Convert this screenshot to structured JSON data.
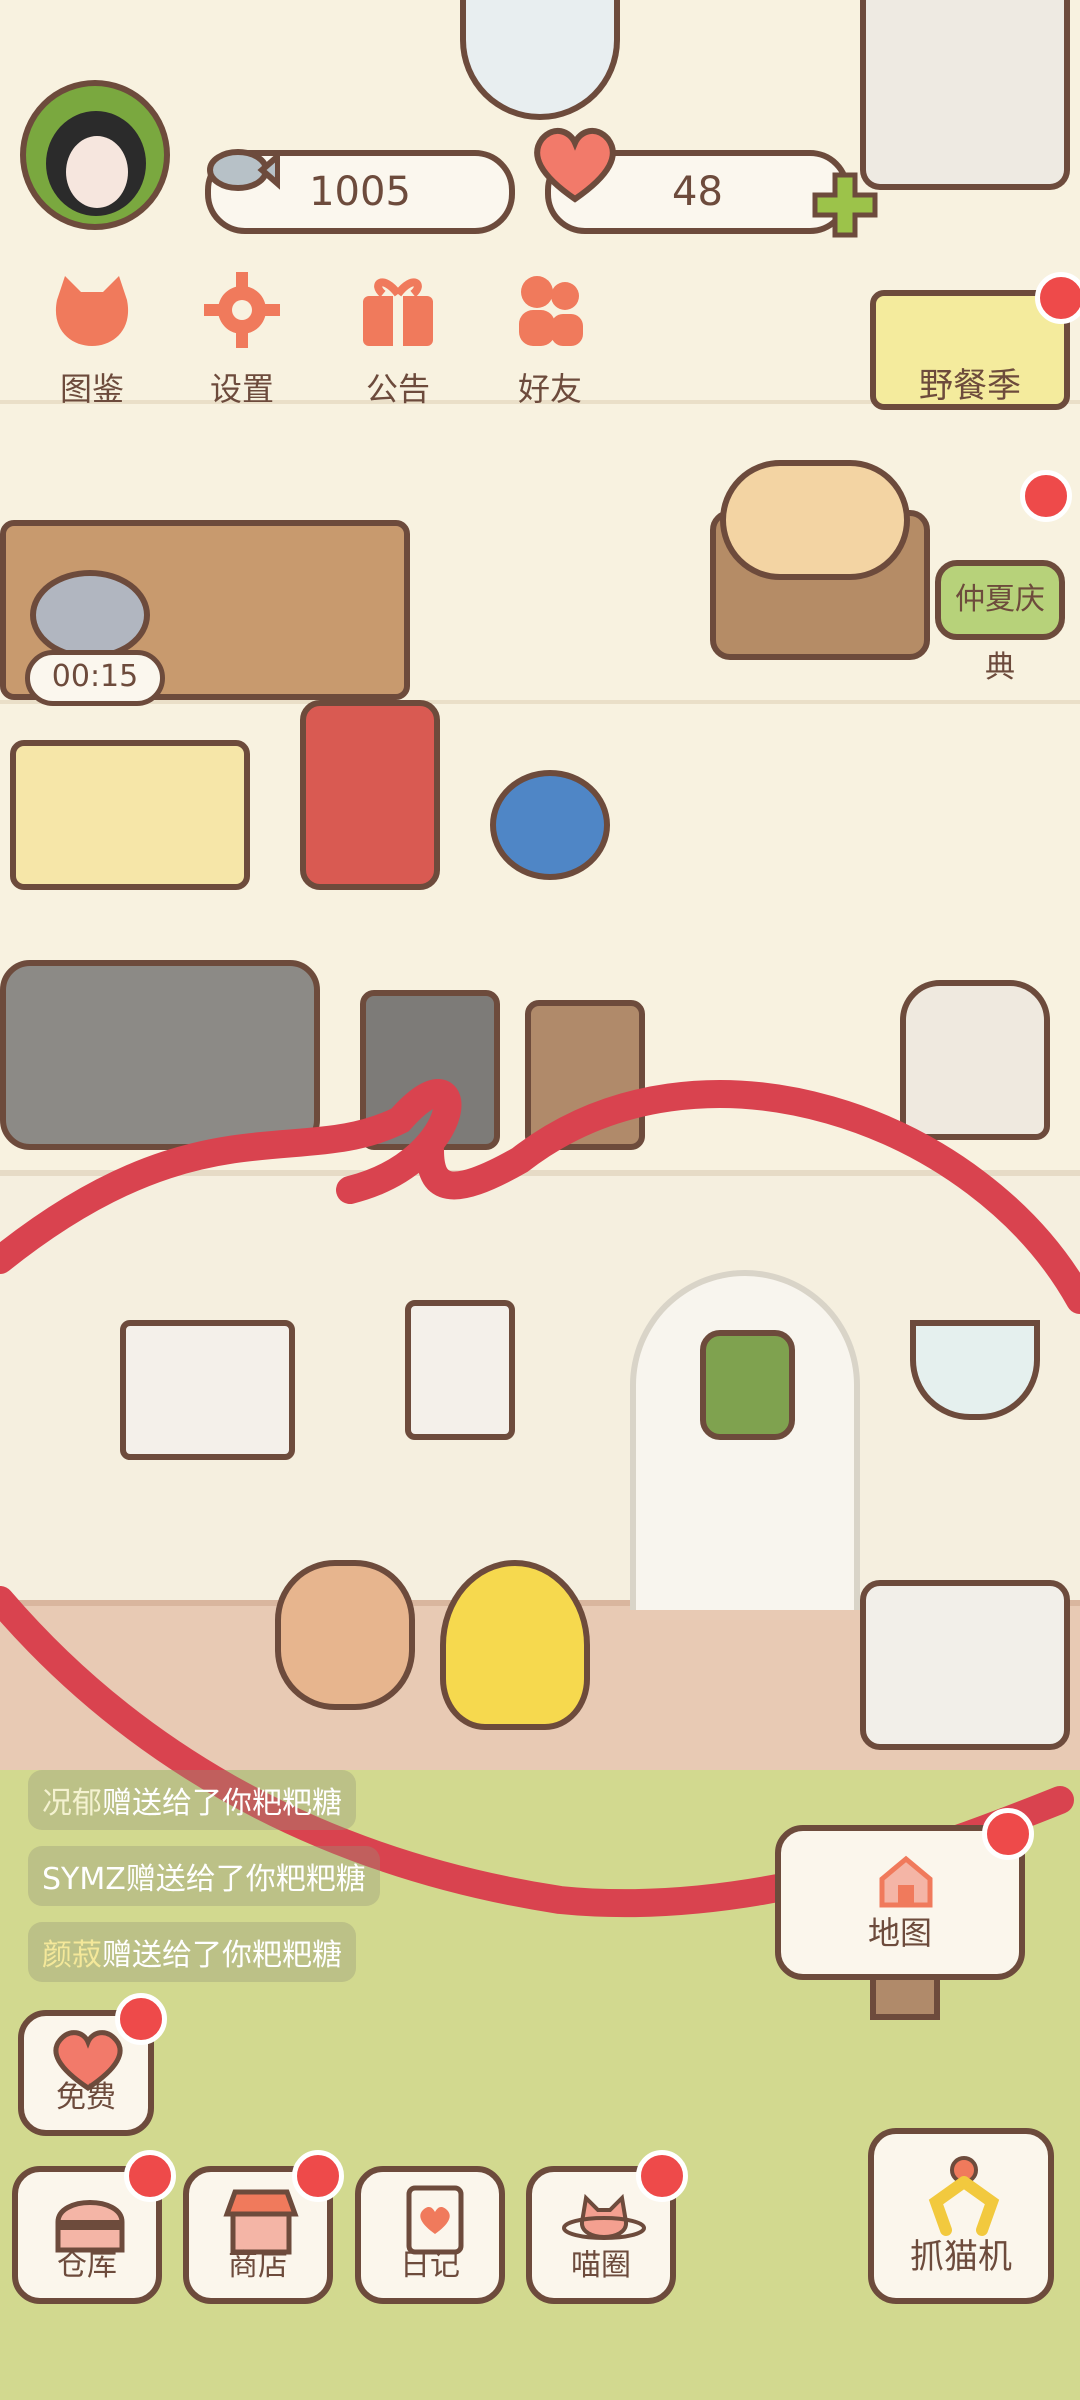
{
  "status": {
    "coins": "1005",
    "hearts": "48",
    "timer": "00:15"
  },
  "top_menu": {
    "catalog": "图鉴",
    "settings": "设置",
    "notice": "公告",
    "friends": "好友"
  },
  "events": {
    "picnic": "野餐季",
    "summer": "仲夏庆典"
  },
  "gift_feed": [
    {
      "name": "况郁",
      "text": "赠送给了你粑粑糖"
    },
    {
      "name": "SYMZ",
      "text": "赠送给了你粑粑糖"
    },
    {
      "name": "颜菽",
      "text": "赠送给了你粑粑糖"
    }
  ],
  "bottom": {
    "free": "免费",
    "warehouse": "仓库",
    "shop": "商店",
    "diary": "日记",
    "circle": "喵圈",
    "map": "地图",
    "claw": "抓猫机"
  },
  "colors": {
    "accent": "#f07a5c",
    "outline": "#6d4b3c",
    "badge": "#ee4a4a",
    "annotation": "#d9434f"
  },
  "icons": [
    "avatar",
    "fish-icon",
    "heart-icon",
    "plus-icon",
    "cat-book-icon",
    "gear-icon",
    "gift-icon",
    "friends-icon",
    "mouse-timer-icon",
    "heart-free-icon",
    "warehouse-icon",
    "shop-icon",
    "diary-icon",
    "cat-planet-icon",
    "map-house-icon",
    "claw-icon"
  ]
}
